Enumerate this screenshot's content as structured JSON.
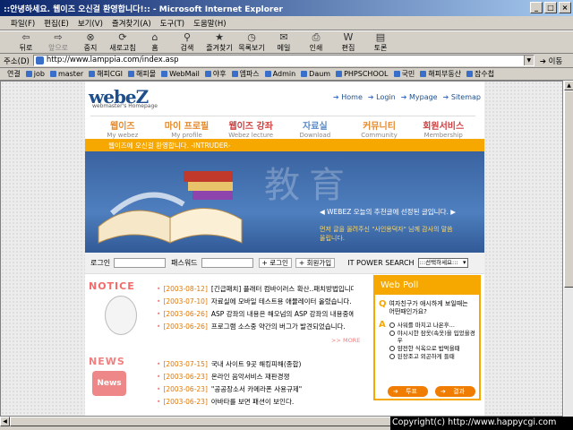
{
  "window": {
    "title": "::안녕하세요. 웹이즈 오신걸 환영합니다!:: - Microsoft Internet Explorer"
  },
  "menu": [
    "파일(F)",
    "편집(E)",
    "보기(V)",
    "즐겨찾기(A)",
    "도구(T)",
    "도움말(H)"
  ],
  "toolbar": [
    {
      "label": "뒤로",
      "icon": "back-arrow-icon",
      "glyph": "⇦",
      "enabled": true
    },
    {
      "label": "앞으로",
      "icon": "forward-arrow-icon",
      "glyph": "⇨",
      "enabled": false
    },
    {
      "label": "중지",
      "icon": "stop-icon",
      "glyph": "⊗",
      "enabled": true
    },
    {
      "label": "새로고침",
      "icon": "refresh-icon",
      "glyph": "⟳",
      "enabled": true
    },
    {
      "label": "홈",
      "icon": "home-icon",
      "glyph": "⌂",
      "enabled": true
    },
    {
      "label": "검색",
      "icon": "search-icon",
      "glyph": "⚲",
      "enabled": true
    },
    {
      "label": "즐겨찾기",
      "icon": "favorites-icon",
      "glyph": "★",
      "enabled": true
    },
    {
      "label": "목록보기",
      "icon": "history-icon",
      "glyph": "◷",
      "enabled": true
    },
    {
      "label": "메일",
      "icon": "mail-icon",
      "glyph": "✉",
      "enabled": true
    },
    {
      "label": "인쇄",
      "icon": "print-icon",
      "glyph": "⎙",
      "enabled": true
    },
    {
      "label": "편집",
      "icon": "edit-icon",
      "glyph": "W",
      "enabled": true
    },
    {
      "label": "토론",
      "icon": "discuss-icon",
      "glyph": "▤",
      "enabled": true
    }
  ],
  "address": {
    "label": "주소(D)",
    "url": "http://www.lamppia.com/index.asp",
    "go": "이동"
  },
  "links": {
    "label": "연결",
    "items": [
      "job",
      "master",
      "해피CGI",
      "해피몰",
      "WebMail",
      "야후",
      "엠파스",
      "Admin",
      "Daum",
      "PHPSCHOOL",
      "국민",
      "해피부동산",
      "잡수첩"
    ]
  },
  "site": {
    "logo": "webeZ",
    "logo_sub": "webmaster's Homepage",
    "toplinks": [
      "Home",
      "Login",
      "Mypage",
      "Sitemap"
    ],
    "nav": [
      {
        "k": "웹이즈",
        "e": "My webez",
        "color": "#e58a2e"
      },
      {
        "k": "마이 프로필",
        "e": "My profile",
        "color": "#e58a2e"
      },
      {
        "k": "웹이즈 강좌",
        "e": "Webez lecture",
        "color": "#d04040"
      },
      {
        "k": "자료실",
        "e": "Download",
        "color": "#5b8cc8"
      },
      {
        "k": "커뮤니티",
        "e": "Community",
        "color": "#e58a2e"
      },
      {
        "k": "회원서비스",
        "e": "Membership",
        "color": "#d04040"
      }
    ],
    "band": "웹이즈에 오신걸 환영합니다. -INTRUDER-",
    "hero_kanji": "教育",
    "hero_line1": "◀ WEBEZ 오늘의 추천글에 선정된 글입니다. ▶",
    "hero_line2": "먼저 글을 올려주신 \"사인용덕자\" 님께 감사의 말씀 올립니다.",
    "login": {
      "id_label": "로그인",
      "pw_label": "패스워드",
      "login_btn": "로그인",
      "join_btn": "회원가입",
      "search_label": "POWER SEARCH",
      "search_select": ":::선택하세요:::"
    },
    "notice": {
      "title": "NOTICE",
      "items": [
        {
          "date": "[2003-08-12]",
          "text": "[긴급패치] 플래터 컴바이러스 확산..패치방법입니다."
        },
        {
          "date": "[2003-07-10]",
          "text": "자료실에 모바일 테스트용 애뮬레이터 올렸습니다."
        },
        {
          "date": "[2003-06-26]",
          "text": "ASP 강좌의 내용은 해오넘의 ASP 강좌의 내용중에..."
        },
        {
          "date": "[2003-06-26]",
          "text": "프로그램 소스중 약간의 버그가 발견되었습니다."
        }
      ],
      "more": ">> MORE"
    },
    "news": {
      "title": "NEWS",
      "fig": "News",
      "items": [
        {
          "date": "[2003-07-15]",
          "text": "국내 사이트 9곳 해킹피해(종합)"
        },
        {
          "date": "[2003-06-23]",
          "text": "온라인 음악서비스 재판경쟁"
        },
        {
          "date": "[2003-06-23]",
          "text": "\"공공장소서 카메라폰 사용규제\""
        },
        {
          "date": "[2003-06-23]",
          "text": "아바타를 보면 패션이 보인다."
        }
      ]
    },
    "poll": {
      "title": "Web Poll",
      "q_mark": "Q",
      "question": "여자친구가 애시하게 보일때는 어떤때인가요?",
      "a_mark": "A",
      "options": [
        "사워를 마치고 나온후...",
        "야시시한 잠옷(속옷)을 입었을경우",
        "얌전한 식옥으로 밥먹을때",
        "된장조고 외곤하게 들때"
      ],
      "vote": "투표",
      "result": "결과"
    }
  },
  "status": {
    "text": "Copyright(c) http://www.happycgi.com"
  }
}
